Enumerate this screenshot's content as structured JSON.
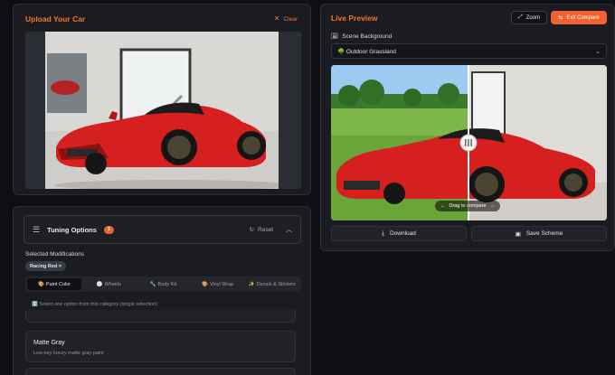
{
  "upload": {
    "title": "Upload Your Car",
    "clear_label": "Clear"
  },
  "tuning": {
    "title": "Tuning Options",
    "count": "1",
    "reset_label": "Reset",
    "selected_label": "Selected Modifications",
    "selected_chip": "Racing Red ×",
    "categories": [
      {
        "icon": "🎨",
        "label": "Paint Color"
      },
      {
        "icon": "⚪",
        "label": "Wheels"
      },
      {
        "icon": "🔧",
        "label": "Body Kit"
      },
      {
        "icon": "🎨",
        "label": "Vinyl Wrap"
      },
      {
        "icon": "✨",
        "label": "Decals & Stickers"
      }
    ],
    "hint": "ℹ️ Select one option from this category (single selection)",
    "options": [
      {
        "title": "Matte Gray",
        "desc": "Low-key luxury matte gray paint"
      }
    ]
  },
  "preview": {
    "title": "Live Preview",
    "zoom_label": "Zoom",
    "exit_label": "Exit Compare",
    "scene_label": "Scene Background",
    "scene_value": "🌳 Outdoor Grassland",
    "drag_hint": "Drag to compare",
    "download_label": "Download",
    "save_label": "Save Scheme"
  },
  "colors": {
    "accent": "#f2622e",
    "panel": "#1a1c21",
    "background": "#0e0f13"
  }
}
